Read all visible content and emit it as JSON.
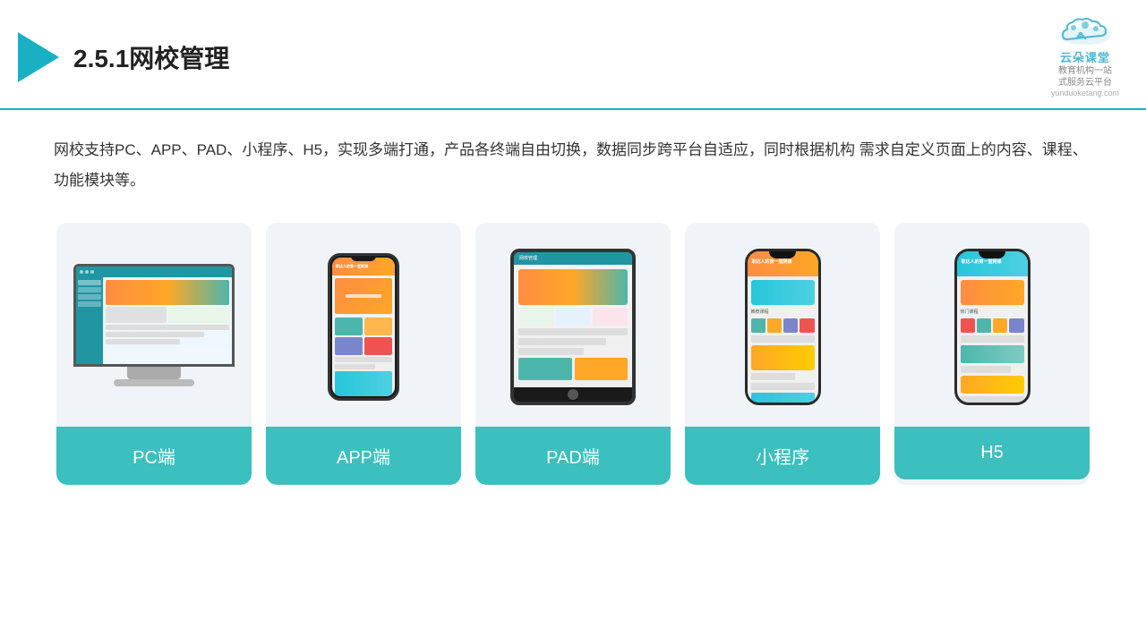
{
  "header": {
    "title": "2.5.1网校管理",
    "brand_name": "云朵课堂",
    "brand_domain": "yunduoketang.com",
    "brand_sub": "教育机构一站\n式服务云平台"
  },
  "description": "网校支持PC、APP、PAD、小程序、H5，实现多端打通，产品各终端自由切换，数据同步跨平台自适应，同时根据机构\n需求自定义页面上的内容、课程、功能模块等。",
  "cards": [
    {
      "id": "pc",
      "label": "PC端"
    },
    {
      "id": "app",
      "label": "APP端"
    },
    {
      "id": "pad",
      "label": "PAD端"
    },
    {
      "id": "mini",
      "label": "小程序"
    },
    {
      "id": "h5",
      "label": "H5"
    }
  ]
}
